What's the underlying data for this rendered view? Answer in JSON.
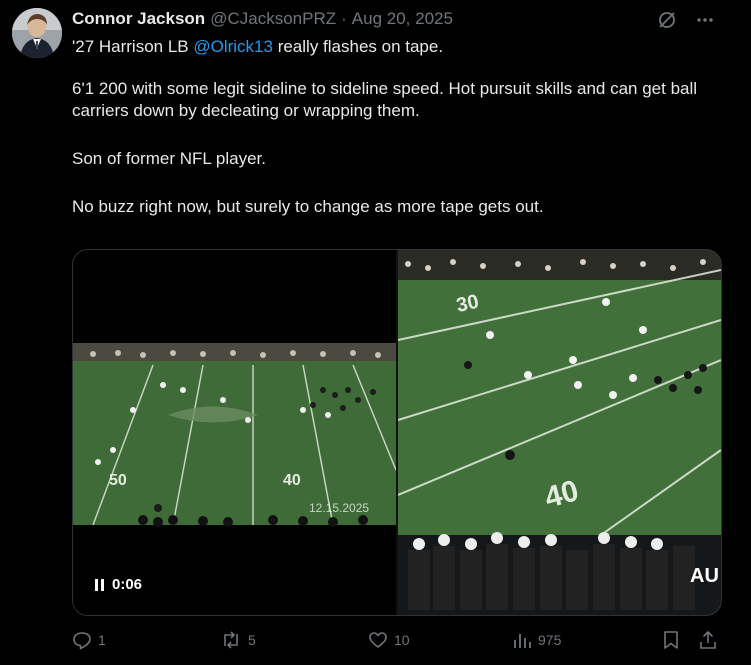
{
  "author": {
    "name": "Connor Jackson",
    "handle": "@CJacksonPRZ",
    "separator": "·",
    "date": "Aug 20, 2025"
  },
  "tweet": {
    "line1_prefix": "'27 Harrison LB ",
    "mention": "@Olrick13",
    "line1_suffix": " really flashes on tape.",
    "p2": "6'1 200 with some legit sideline to sideline speed. Hot pursuit skills and can get ball carriers down by decleating or wrapping them.",
    "p3": "Son of former NFL player.",
    "p4": "No buzz right now, but surely to change as more tape gets out."
  },
  "media": {
    "time": "0:06",
    "left_overlay": {
      "yard_left": "50",
      "yard_right": "40",
      "stamp": "12.15.2025"
    },
    "right_overlay": {
      "yard_top": "30",
      "yard_mid": "40",
      "corner": "AU"
    }
  },
  "actions": {
    "replies": "1",
    "reposts": "5",
    "likes": "10",
    "views": "975"
  },
  "colors": {
    "background": "#000000",
    "text": "#e7e9ea",
    "muted": "#71767b",
    "link": "#1d9bf0",
    "field": "#3f6b38"
  },
  "icons": [
    "grok-slash-icon",
    "more-icon",
    "reply-icon",
    "repost-icon",
    "like-icon",
    "views-icon",
    "bookmark-icon",
    "share-icon",
    "pause-icon"
  ]
}
